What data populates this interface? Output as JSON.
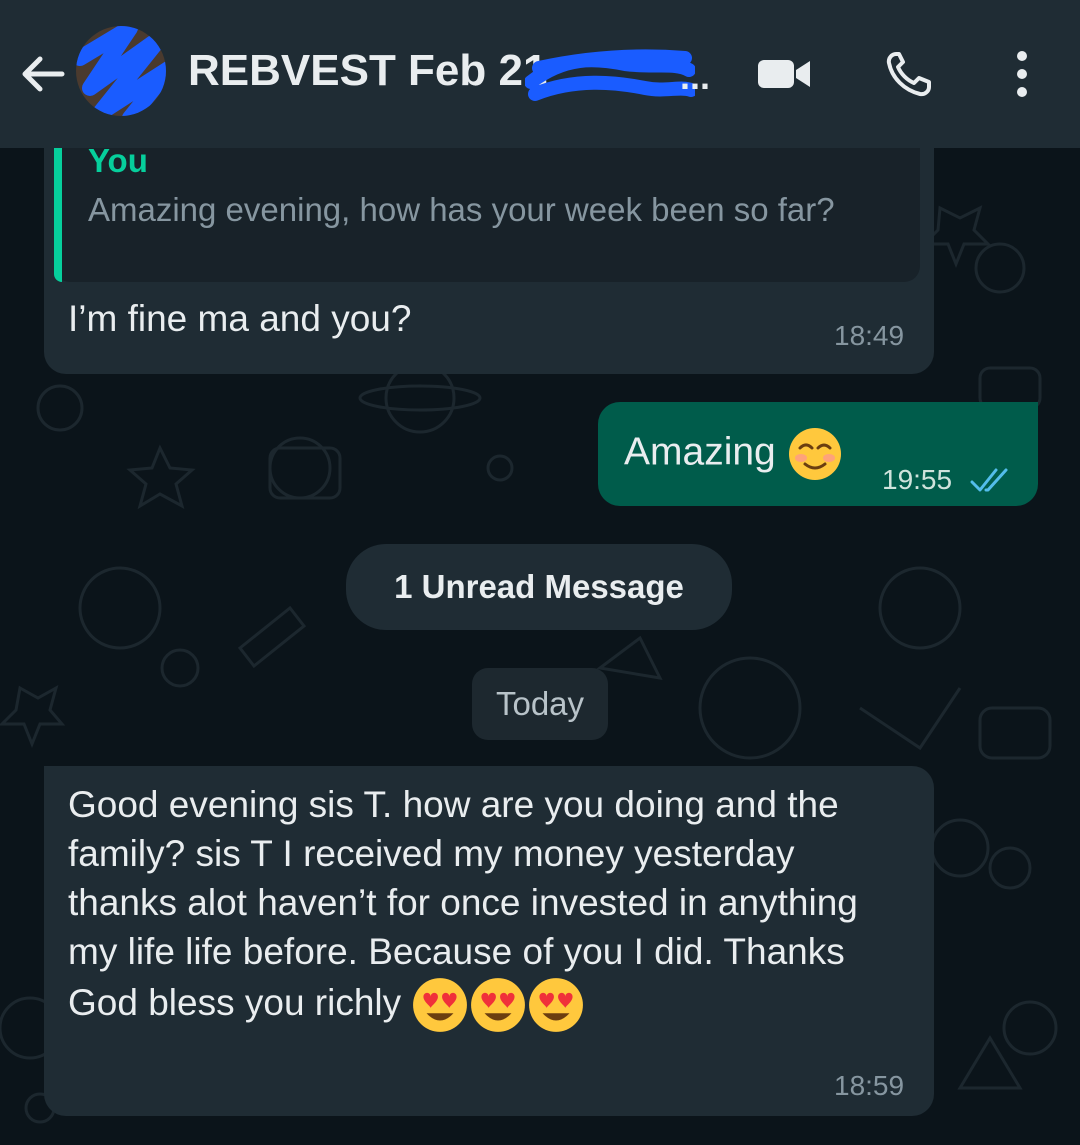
{
  "header": {
    "title": "REBVEST Feb 21",
    "title_ellipsis": "...",
    "back_icon": "arrow-left-icon",
    "video_icon": "video-camera-icon",
    "call_icon": "phone-icon",
    "menu_icon": "more-vertical-icon"
  },
  "messages": [
    {
      "direction": "in",
      "quote_author": "You",
      "quote_text": "Amazing evening,  how has your week been so far?",
      "text": "I’m fine ma and you?",
      "time": "18:49"
    },
    {
      "direction": "out",
      "text": "Amazing",
      "emoji": "smiling-face-with-smiling-eyes",
      "time": "19:55",
      "status": "read-double-check-icon"
    },
    {
      "direction": "in",
      "text": "Good evening sis T. how are you doing and the family? sis T I received my money yesterday thanks alot haven’t for once invested in anything my life life before. Because of you I did. Thanks God bless you richly",
      "emoji": [
        "smiling-face-with-heart-eyes",
        "smiling-face-with-heart-eyes",
        "smiling-face-with-heart-eyes"
      ],
      "time": "18:59"
    }
  ],
  "unread_banner": "1 Unread Message",
  "date_divider": "Today",
  "colors": {
    "header_bg": "#1f2c34",
    "chat_bg": "#0b141a",
    "incoming_bubble": "#1f2c34",
    "outgoing_bubble": "#005c4b",
    "accent": "#06cf9c",
    "read_ticks": "#53bdeb",
    "redaction": "#1a5cff"
  }
}
